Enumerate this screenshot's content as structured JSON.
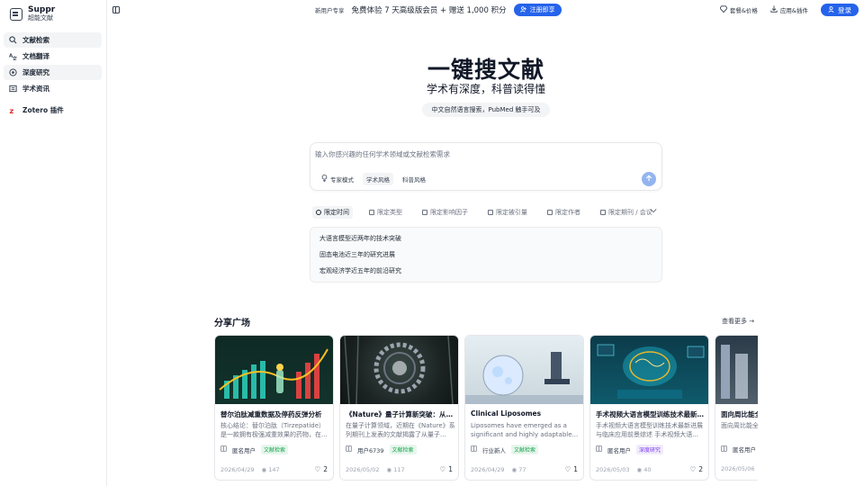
{
  "brand": {
    "name": "Suppr",
    "sub": "超能文献"
  },
  "sidebar": {
    "items": [
      {
        "label": "文献检索",
        "icon": "search-icon"
      },
      {
        "label": "文档翻译",
        "icon": "translate-icon"
      },
      {
        "label": "深度研究",
        "icon": "research-icon"
      },
      {
        "label": "学术资讯",
        "icon": "news-icon"
      },
      {
        "label": "Zotero 插件",
        "icon": "zotero-icon"
      }
    ]
  },
  "topbar": {
    "promo_tag": "新用户专享",
    "promo_text": "免费体验 7 天高级版会员 + 赠送 1,000 积分",
    "register": "注册即享",
    "pricing": "套餐&价格",
    "apps": "应用&插件",
    "login": "登录"
  },
  "hero": {
    "title": "一键搜文献",
    "subtitle": "学术有深度，科普读得懂",
    "pill": "中文自然语言搜索，PubMed 触手可及"
  },
  "search": {
    "placeholder": "输入你感兴趣的任何学术领域或文献检索需求",
    "modes": [
      "专家模式",
      "学术风格",
      "科普风格"
    ]
  },
  "filters": [
    "限定时间",
    "限定类型",
    "限定影响因子",
    "限定被引量",
    "限定作者",
    "限定期刊 / 会议"
  ],
  "suggestions": [
    "大语言模型近两年的技术突破",
    "固态电池近三年的研究进展",
    "宏观经济学近五年的前沿研究"
  ],
  "share": {
    "title": "分享广场",
    "more": "查看更多",
    "cards": [
      {
        "title": "替尔泊肽减重数据及停药反弹分析",
        "desc": "核心结论：替尔泊肽（Tirzepatide）是一款拥有极强减重效果的药物，在...",
        "user": "匿名用户",
        "tag": "文献检索",
        "tag_type": "green",
        "date": "2026/04/29",
        "views": "147",
        "likes": "2"
      },
      {
        "title": "《Nature》量子计算新突破：从硬...",
        "desc": "在量子计算领域，近期在《Nature》系列期刊上发表的文献揭露了从量子...",
        "user": "用户6739",
        "tag": "文献检索",
        "tag_type": "green",
        "date": "2026/05/02",
        "views": "117",
        "likes": "1"
      },
      {
        "title": "Clinical Liposomes",
        "desc": "Liposomes have emerged as a significant and highly adaptable...",
        "user": "行业新人",
        "tag": "文献检索",
        "tag_type": "green",
        "date": "2026/04/29",
        "views": "77",
        "likes": "1"
      },
      {
        "title": "手术视频大语言模型训练技术最新进...",
        "desc": "手术视频大语言模型训练技术最新进展与临床应用前景综述 手术视频大语...",
        "user": "匿名用户",
        "tag": "深度研究",
        "tag_type": "purple",
        "date": "2026/05/03",
        "views": "40",
        "likes": "2"
      },
      {
        "title": "面向周比能全",
        "desc": "面向周比能全界面工程关键",
        "user": "匿名用户",
        "tag": "",
        "tag_type": "green",
        "date": "2026/05/06",
        "views": "",
        "likes": ""
      }
    ]
  },
  "colors": {
    "accent": "#2563eb",
    "tag_green": "#16a34a",
    "tag_purple": "#7c3aed"
  }
}
